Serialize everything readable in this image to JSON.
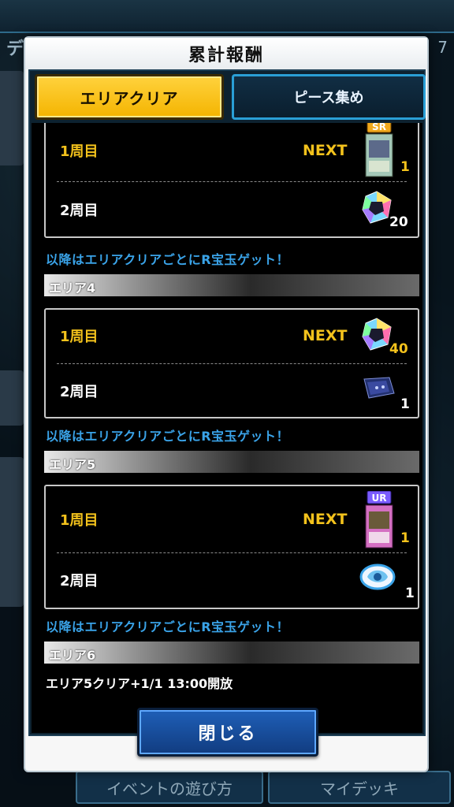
{
  "background": {
    "title_fragment": "デュ",
    "corner_number": "7",
    "bottom_buttons": [
      "イベントの遊び方",
      "マイデッキ"
    ]
  },
  "modal": {
    "title": "累計報酬",
    "tabs": [
      {
        "label": "エリアクリア",
        "active": true
      },
      {
        "label": "ピース集め",
        "active": false
      }
    ],
    "close_label": "閉じる"
  },
  "sections": [
    {
      "rows": [
        {
          "label": "1周目",
          "next": "NEXT",
          "reward_icon": "sr-card-icon",
          "rarity": "SR",
          "qty": "1",
          "qty_color": "yellow"
        },
        {
          "label": "2周目",
          "reward_icon": "gem-icon",
          "qty": "20",
          "qty_color": "white"
        }
      ],
      "note": "以降はエリアクリアごとにR宝玉ゲット！"
    },
    {
      "area": "エリア4",
      "rows": [
        {
          "label": "1周目",
          "next": "NEXT",
          "reward_icon": "gem-icon",
          "qty": "40",
          "qty_color": "yellow"
        },
        {
          "label": "2周目",
          "reward_icon": "sleeve-icon",
          "qty": "1",
          "qty_color": "white"
        }
      ],
      "note": "以降はエリアクリアごとにR宝玉ゲット！"
    },
    {
      "area": "エリア5",
      "rows": [
        {
          "label": "1周目",
          "next": "NEXT",
          "reward_icon": "ur-card-icon",
          "rarity": "UR",
          "qty": "1",
          "qty_color": "yellow"
        },
        {
          "label": "2周目",
          "reward_icon": "icon-badge-icon",
          "qty": "1",
          "qty_color": "white"
        }
      ],
      "note": "以降はエリアクリアごとにR宝玉ゲット！"
    },
    {
      "area": "エリア6",
      "unlock": "エリア5クリア+1/1 13:00開放"
    }
  ],
  "colors": {
    "accent_yellow": "#f3c21c",
    "note_blue": "#3aa3e8",
    "tab_active": "#f4b400",
    "tab_border": "#2a9fd6",
    "close_button": "#1f5fb8"
  }
}
